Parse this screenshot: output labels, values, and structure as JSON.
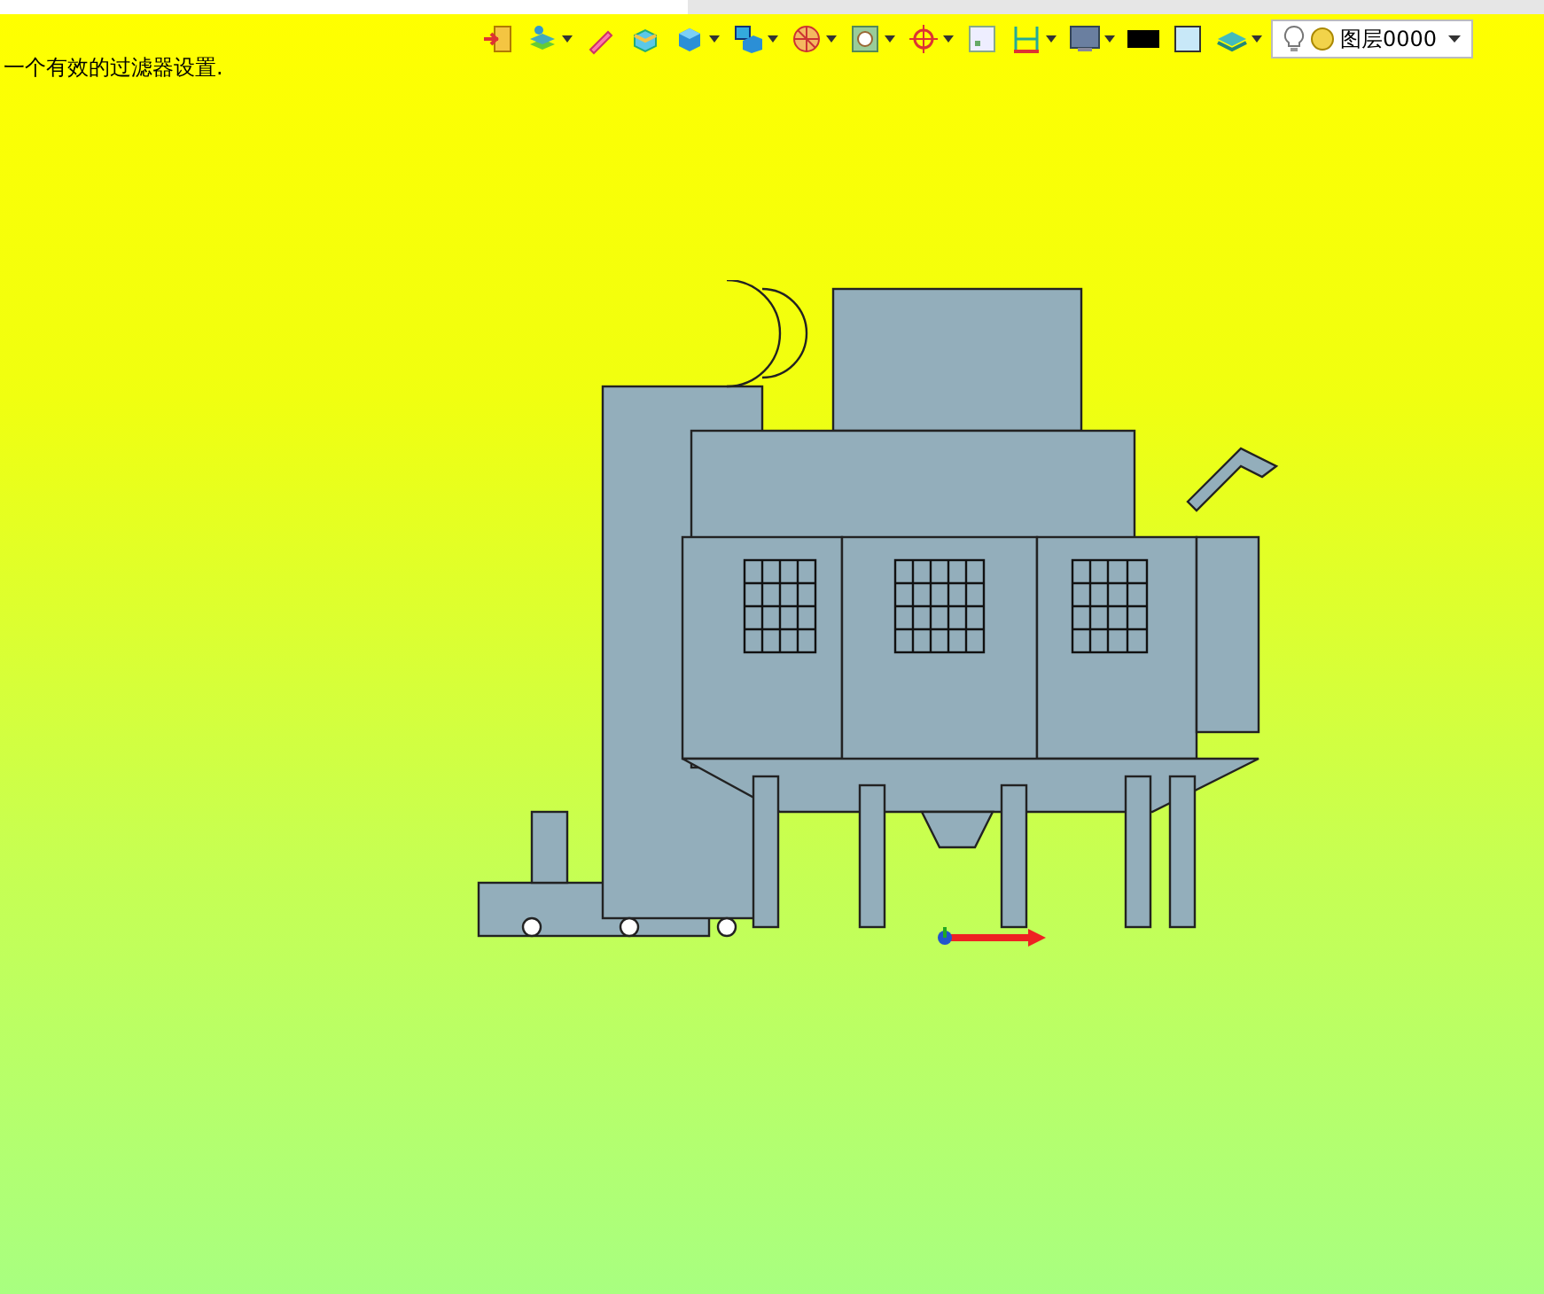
{
  "status_message": "一个有效的过滤器设置.",
  "toolbar": [
    {
      "kind": "exit",
      "dropdown": false
    },
    {
      "kind": "layers",
      "dropdown": true
    },
    {
      "kind": "pen",
      "dropdown": false
    },
    {
      "kind": "box-plane",
      "dropdown": false
    },
    {
      "kind": "cube",
      "dropdown": true
    },
    {
      "kind": "view",
      "dropdown": true
    },
    {
      "kind": "sphere",
      "dropdown": true
    },
    {
      "kind": "zoom",
      "dropdown": true
    },
    {
      "kind": "target",
      "dropdown": true
    },
    {
      "kind": "frame",
      "dropdown": false
    },
    {
      "kind": "dimension",
      "dropdown": true
    },
    {
      "kind": "monitor",
      "dropdown": true
    },
    {
      "kind": "line",
      "dropdown": false
    },
    {
      "kind": "fill",
      "dropdown": false
    },
    {
      "kind": "stack",
      "dropdown": true
    }
  ],
  "layer_selector": {
    "value": "图层0000"
  }
}
